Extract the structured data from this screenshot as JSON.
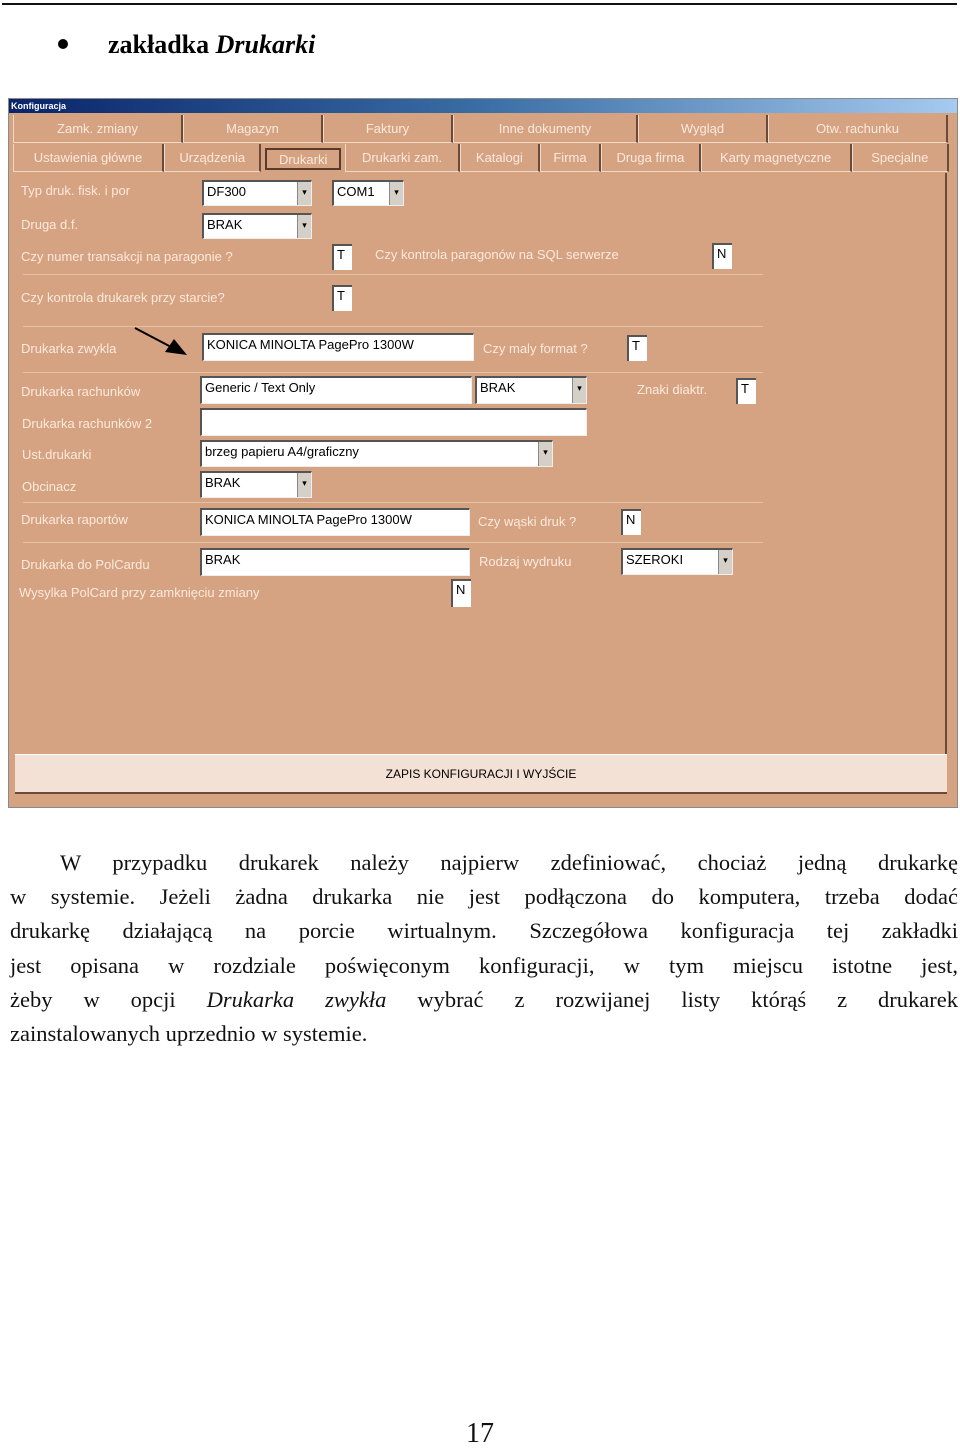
{
  "heading": {
    "prefix": "zakładka",
    "italic": "Drukarki"
  },
  "window": {
    "title": "Konfiguracja",
    "tabs_row1": [
      "Zamk. zmiany",
      "Magazyn",
      "Faktury",
      "Inne dokumenty",
      "Wygląd",
      "Otw. rachunku"
    ],
    "tabs_row2": [
      "Ustawienia główne",
      "Urządzenia",
      "Drukarki",
      "Drukarki zam.",
      "Katalogi",
      "Firma",
      "Druga firma",
      "Karty magnetyczne",
      "Specjalne"
    ],
    "active_tab": "Drukarki",
    "fields": {
      "typ_druk_label": "Typ druk. fisk. i por",
      "typ_druk_value": "DF300",
      "port_value": "COM1",
      "druga_df_label": "Druga d.f.",
      "druga_df_value": "BRAK",
      "nr_trans_label": "Czy numer transakcji na paragonie ?",
      "nr_trans_value": "T",
      "sql_label": "Czy kontrola paragonów na SQL serwerze",
      "sql_value": "N",
      "kontrola_label": "Czy kontrola drukarek przy starcie?",
      "kontrola_value": "T",
      "zwykla_label": "Drukarka zwykla",
      "zwykla_value": "KONICA MINOLTA PagePro 1300W",
      "maly_label": "Czy maly format ?",
      "maly_value": "T",
      "rach_label": "Drukarka rachunków",
      "rach_value": "Generic / Text Only",
      "rach_port_value": "BRAK",
      "znaki_label": "Znaki diaktr.",
      "znaki_value": "T",
      "rach2_label": "Drukarka rachunków 2",
      "rach2_value": "",
      "ust_label": "Ust.drukarki",
      "ust_value": "brzeg papieru A4/graficzny",
      "obcinacz_label": "Obcinacz",
      "obcinacz_value": "BRAK",
      "raport_label": "Drukarka raportów",
      "raport_value": "KONICA MINOLTA PagePro 1300W",
      "waski_label": "Czy wąski druk ?",
      "waski_value": "N",
      "polcard_label": "Drukarka do PolCardu",
      "polcard_value": "BRAK",
      "rodzaj_label": "Rodzaj wydruku",
      "rodzaj_value": "SZEROKI",
      "wysylka_label": "Wysylka PolCard przy zamknięciu zmiany",
      "wysylka_value": "N"
    },
    "dropdown_glyph": "▾",
    "save_button": "ZAPIS KONFIGURACJI I WYJŚCIE"
  },
  "body_lines": [
    "W przypadku drukarek należy najpierw zdefiniować, chociaż jedną drukarkę",
    "w systemie. Jeżeli żadna drukarka nie jest podłączona do komputera, trzeba dodać",
    "drukarkę działającą na porcie wirtualnym. Szczegółowa konfiguracja tej zakładki",
    "jest opisana w rozdziale poświęconym konfiguracji, w tym miejscu istotne jest,",
    "żeby w opcji |Drukarka zwykła| wybrać z rozwijanej listy którąś z drukarek",
    "zainstalowanych uprzednio w systemie."
  ],
  "page_number": "17"
}
